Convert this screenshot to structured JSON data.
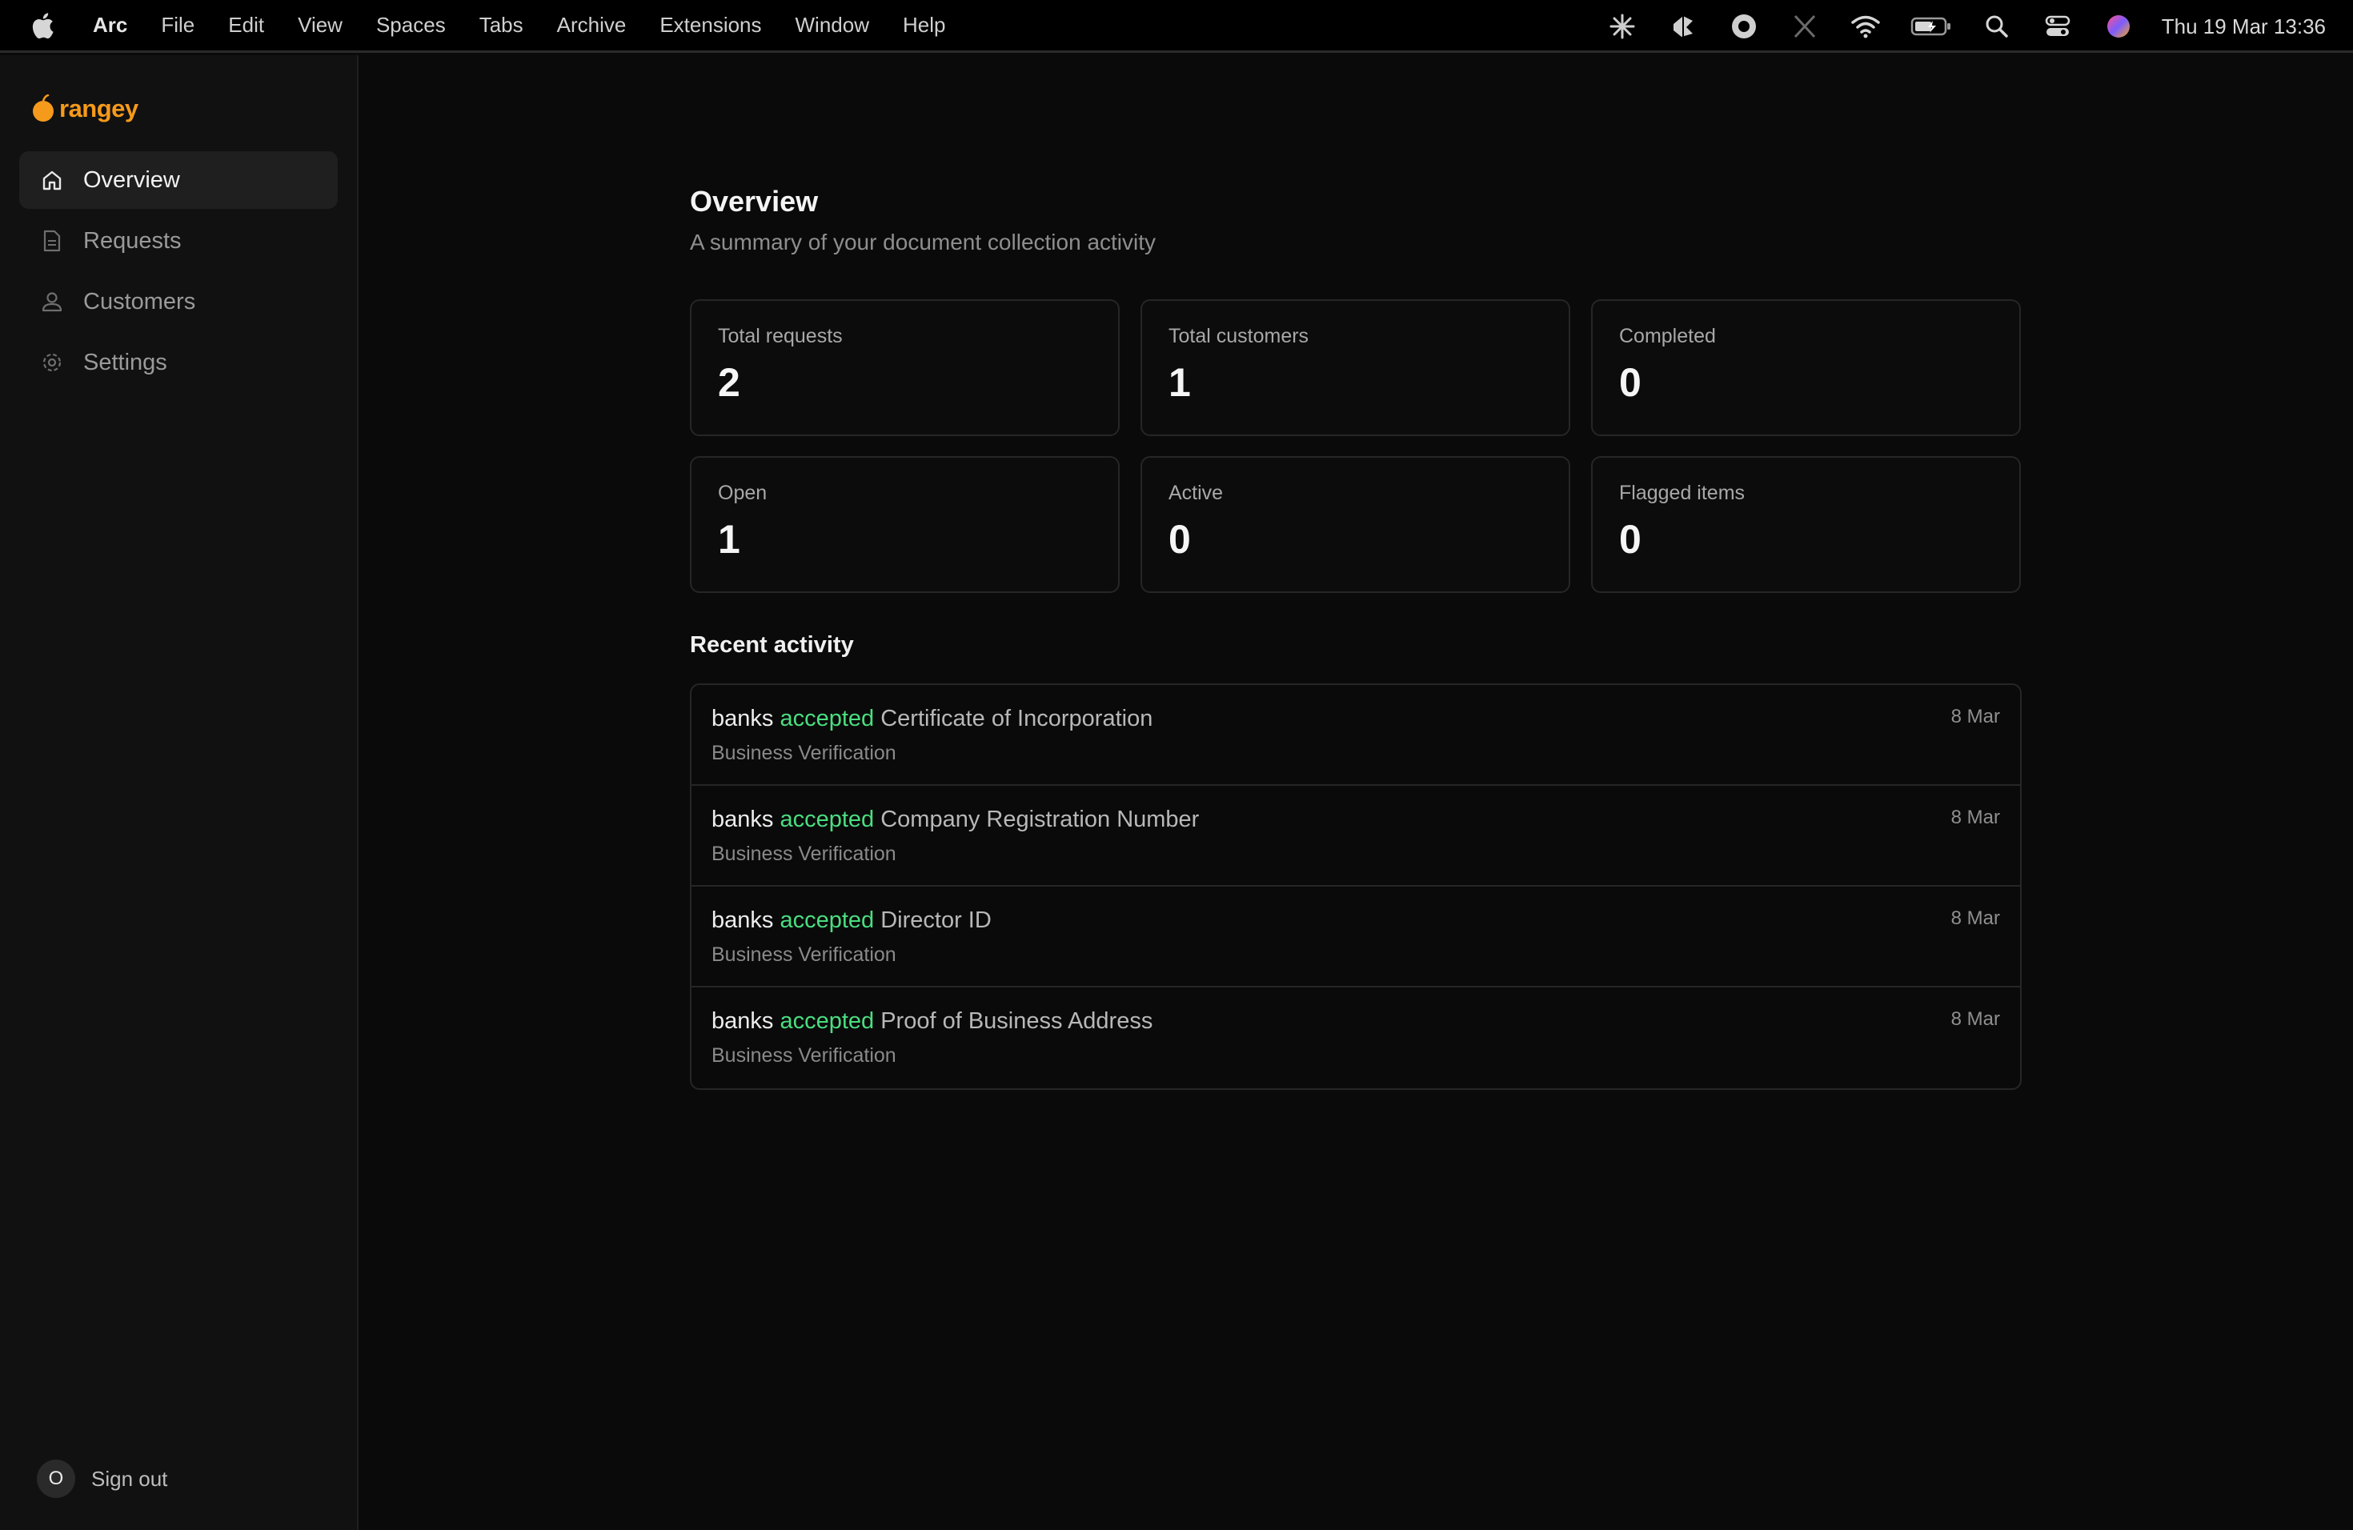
{
  "menubar": {
    "app_name": "Arc",
    "items": [
      "File",
      "Edit",
      "View",
      "Spaces",
      "Tabs",
      "Archive",
      "Extensions",
      "Window",
      "Help"
    ],
    "clock": "Thu 19 Mar  13:36",
    "status_icons": [
      "sparkle-icon",
      "figma-like-icon",
      "record-icon",
      "x-icon",
      "wifi-icon",
      "battery-icon",
      "search-icon",
      "control-center-icon",
      "siri-icon"
    ]
  },
  "sidebar": {
    "brand": "rangey",
    "items": [
      {
        "label": "Overview",
        "icon": "home-icon",
        "active": true
      },
      {
        "label": "Requests",
        "icon": "document-icon",
        "active": false
      },
      {
        "label": "Customers",
        "icon": "user-icon",
        "active": false
      },
      {
        "label": "Settings",
        "icon": "gear-icon",
        "active": false
      }
    ],
    "avatar_initial": "O",
    "signout_label": "Sign out"
  },
  "main": {
    "title": "Overview",
    "subtitle": "A summary of your document collection activity",
    "stats": [
      {
        "label": "Total requests",
        "value": "2"
      },
      {
        "label": "Total customers",
        "value": "1"
      },
      {
        "label": "Completed",
        "value": "0"
      },
      {
        "label": "Open",
        "value": "1"
      },
      {
        "label": "Active",
        "value": "0"
      },
      {
        "label": "Flagged items",
        "value": "0"
      }
    ],
    "recent_title": "Recent activity",
    "activity": [
      {
        "actor": "banks",
        "verb": "accepted",
        "document": "Certificate of Incorporation",
        "category": "Business Verification",
        "date": "8 Mar"
      },
      {
        "actor": "banks",
        "verb": "accepted",
        "document": "Company Registration Number",
        "category": "Business Verification",
        "date": "8 Mar"
      },
      {
        "actor": "banks",
        "verb": "accepted",
        "document": "Director ID",
        "category": "Business Verification",
        "date": "8 Mar"
      },
      {
        "actor": "banks",
        "verb": "accepted",
        "document": "Proof of Business Address",
        "category": "Business Verification",
        "date": "8 Mar"
      }
    ]
  },
  "colors": {
    "brand": "#f59a1b",
    "accepted": "#4ade80",
    "background": "#0a0a0a",
    "sidebar": "#111111"
  }
}
